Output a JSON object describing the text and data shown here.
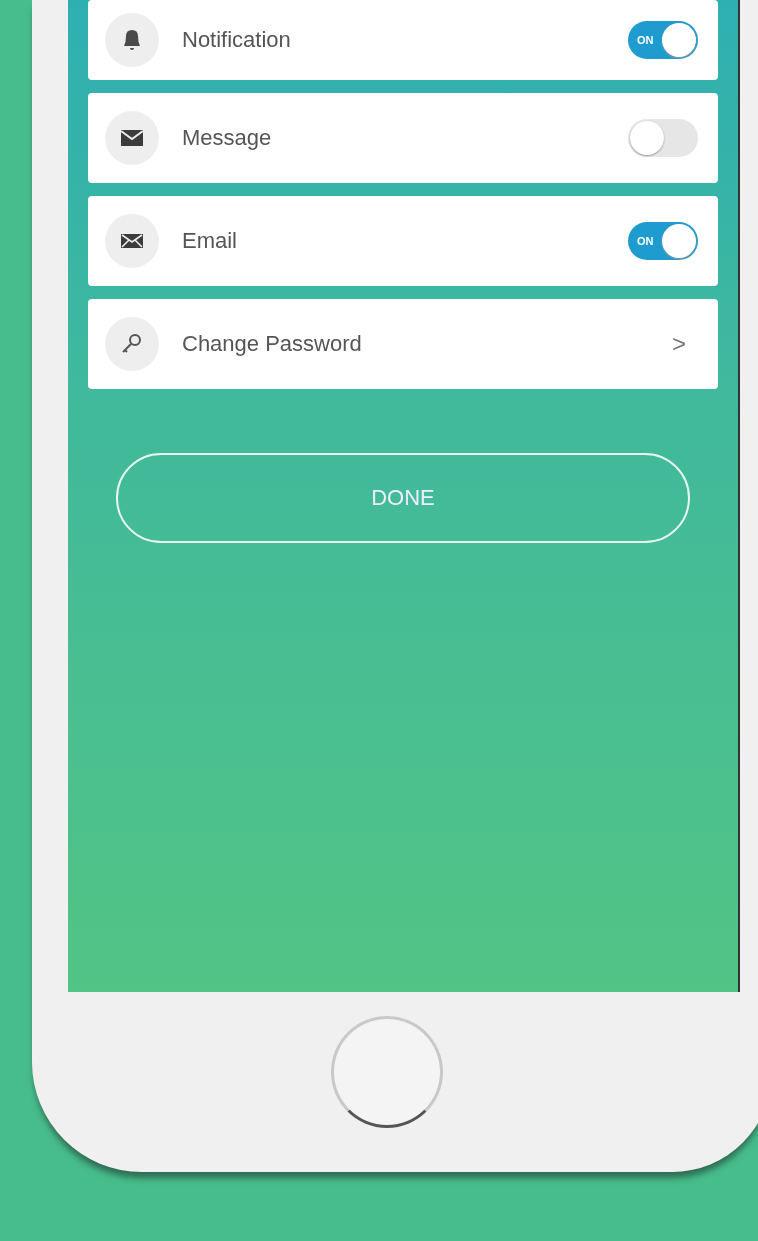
{
  "settings": [
    {
      "label": "Notification",
      "kind": "toggle",
      "on": true,
      "switch_text": "ON"
    },
    {
      "label": "Message",
      "kind": "toggle",
      "on": false
    },
    {
      "label": "Email",
      "kind": "toggle",
      "on": true,
      "switch_text": "ON"
    },
    {
      "label": "Change Password",
      "kind": "link",
      "chevron": ">"
    }
  ],
  "done_button": "DONE"
}
